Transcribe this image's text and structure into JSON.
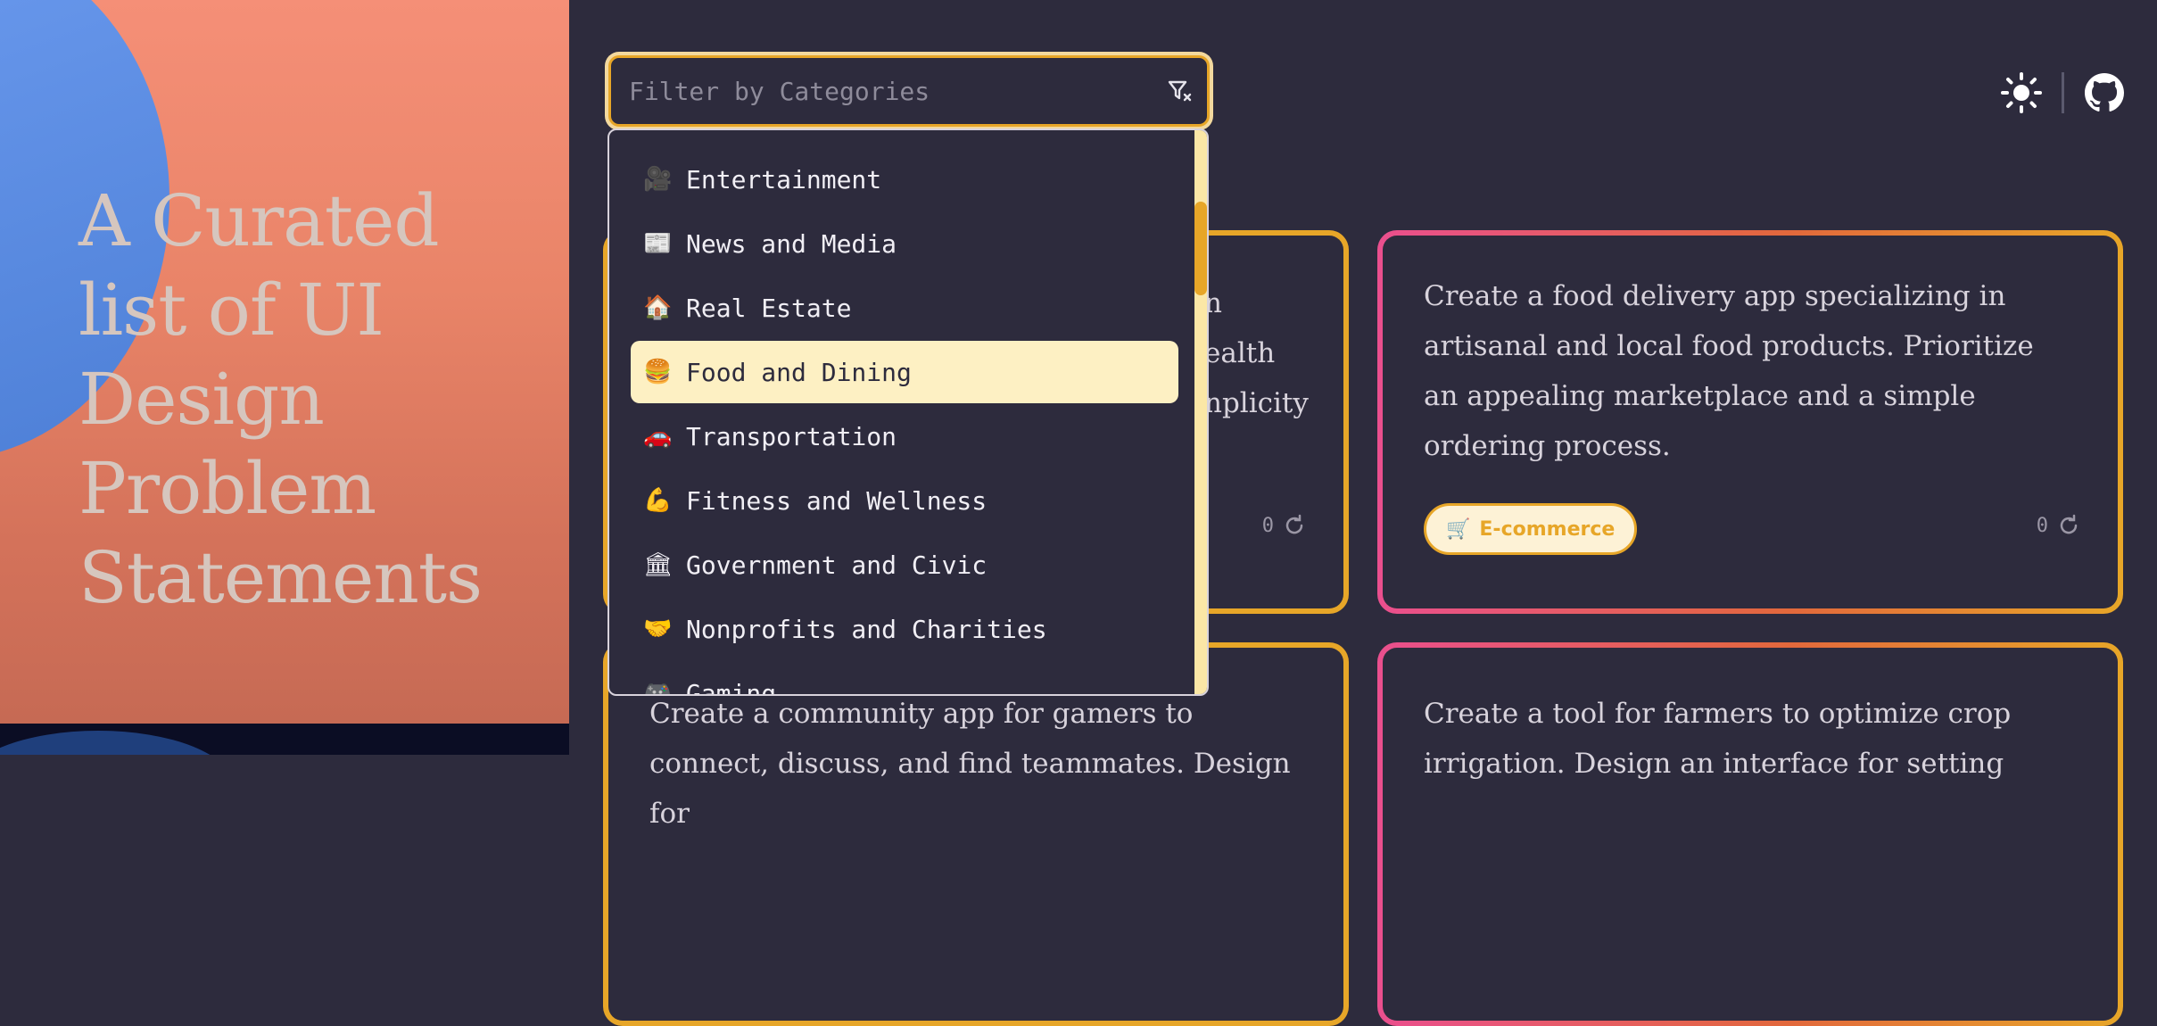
{
  "hero": {
    "title": "A Curated list of UI Design Problem Statements"
  },
  "filter": {
    "placeholder": "Filter by Categories",
    "value": ""
  },
  "categories": [
    {
      "emoji": "🎥",
      "label": "Entertainment"
    },
    {
      "emoji": "📰",
      "label": "News and Media"
    },
    {
      "emoji": "🏠",
      "label": "Real Estate"
    },
    {
      "emoji": "🍔",
      "label": "Food and Dining",
      "active": true
    },
    {
      "emoji": "🚗",
      "label": "Transportation"
    },
    {
      "emoji": "💪",
      "label": "Fitness and Wellness"
    },
    {
      "emoji": "🏛",
      "label": "Government and Civic"
    },
    {
      "emoji": "🤝",
      "label": "Nonprofits and Charities"
    },
    {
      "emoji": "🎮",
      "label": "Gaming"
    }
  ],
  "cards": [
    {
      "text_partial": [
        "n",
        "ealth",
        "nplicity"
      ],
      "count": "0"
    },
    {
      "text": "Create a food delivery app specializing in artisanal and local food products. Prioritize an appealing marketplace and a simple ordering process.",
      "badge_emoji": "🛒",
      "badge": "E-commerce",
      "count": "0"
    },
    {
      "text": "Create a community app for gamers to connect, discuss, and find teammates. Design for"
    },
    {
      "text": "Create a tool for farmers to optimize crop irrigation. Design an interface for setting"
    }
  ],
  "colors": {
    "accent": "#e7a628",
    "pink": "#ea4f8e",
    "background": "#2d2b3d"
  }
}
